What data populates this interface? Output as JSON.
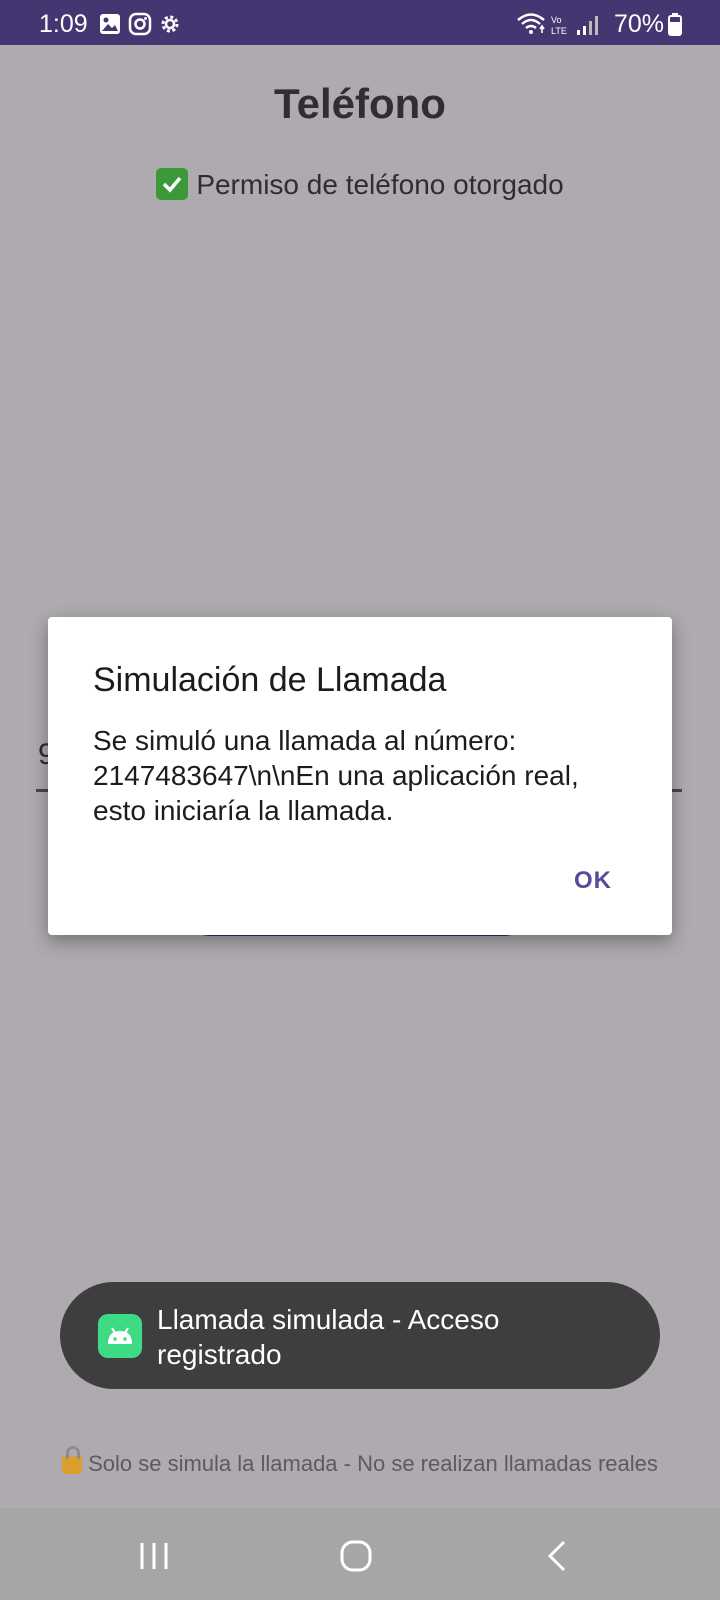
{
  "status_bar": {
    "time": "1:09",
    "battery_percent": "70%",
    "icons": [
      "gallery-icon",
      "instagram-icon",
      "settings-icon",
      "wifi-icon",
      "volte-icon",
      "signal-icon",
      "battery-icon"
    ]
  },
  "app": {
    "title": "Teléfono",
    "permission_text": "Permiso de teléfono otorgado",
    "number_field_value": "9"
  },
  "dialog": {
    "title": "Simulación de Llamada",
    "message": "Se simuló una llamada al número:\n2147483647\\n\\nEn una aplicación real,\nesto iniciaría la llamada.",
    "ok_label": "OK"
  },
  "toast": {
    "text": "Llamada simulada - Acceso registrado"
  },
  "footer": {
    "note": "Solo se simula la llamada - No se realizan llamadas reales"
  },
  "colors": {
    "status_bar": "#443670",
    "scrim_background": "#aeaaaf",
    "accent": "#5a4a9a",
    "toast_background": "#3e3e3e"
  }
}
